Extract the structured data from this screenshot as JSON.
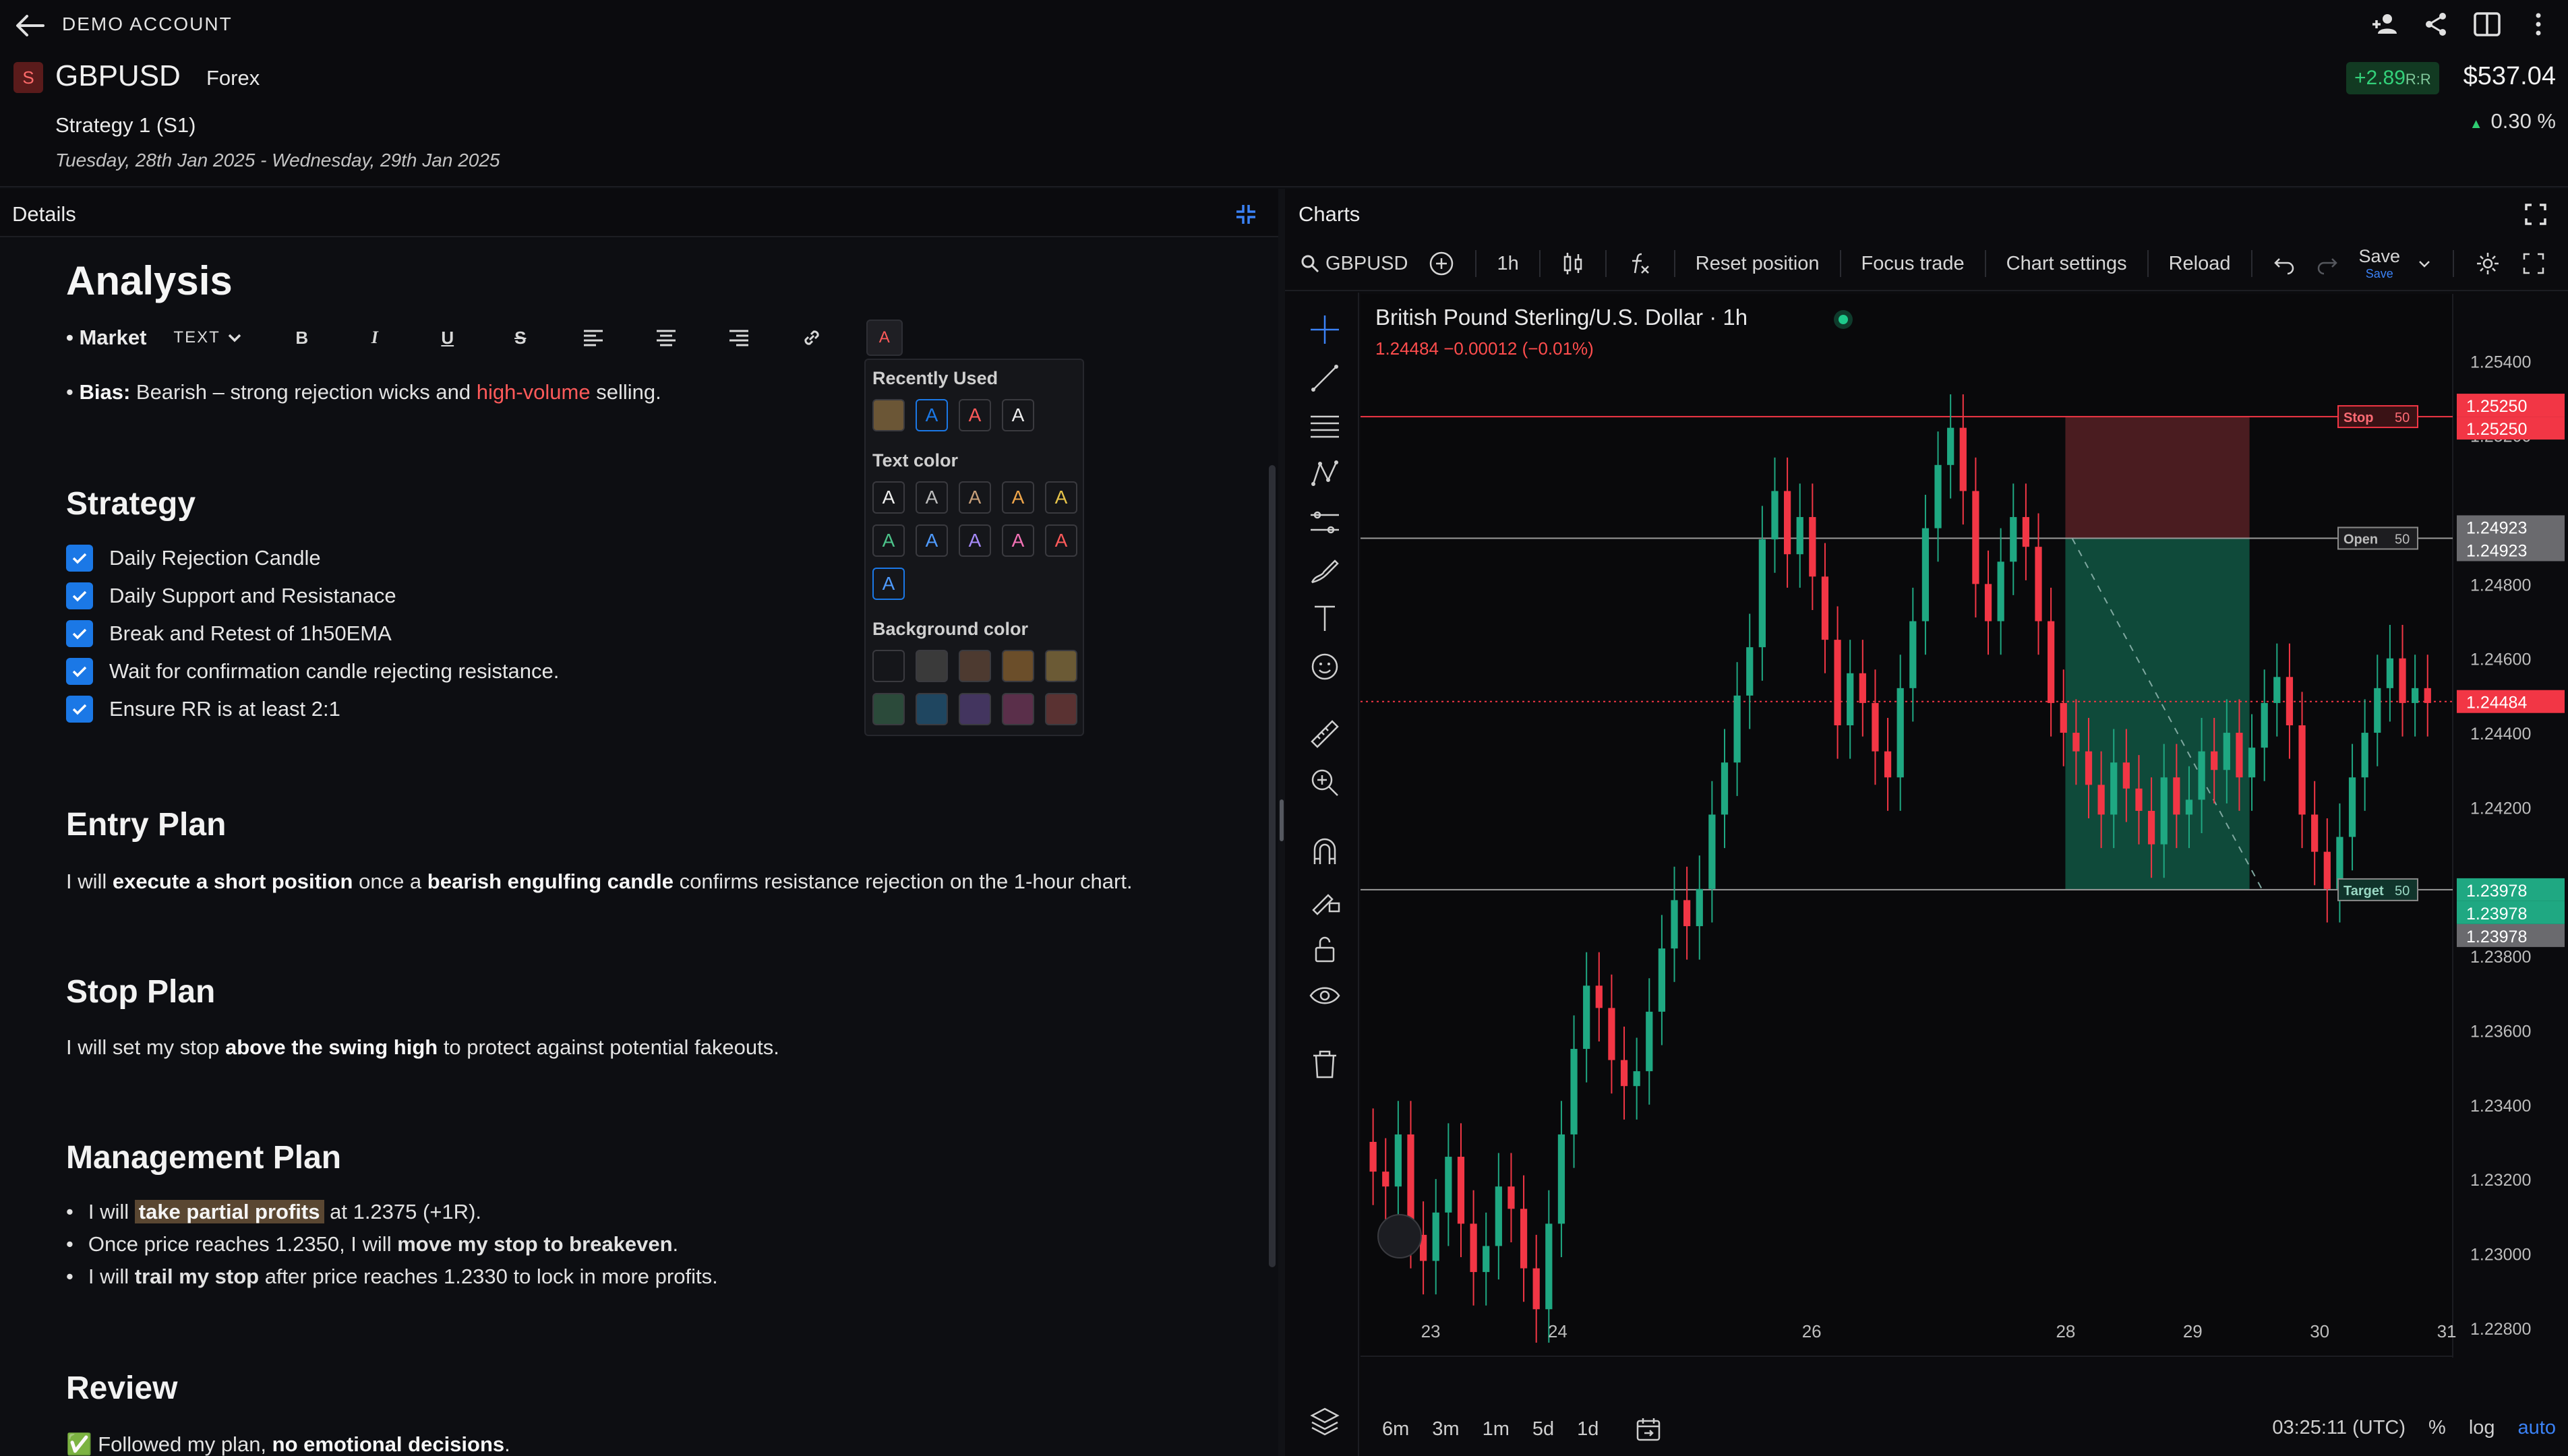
{
  "header": {
    "account_title": "DEMO ACCOUNT",
    "badge_letter": "S",
    "symbol": "GBPUSD",
    "market_type": "Forex",
    "strategy_name": "Strategy 1 (S1)",
    "date_range": "Tuesday, 28th Jan 2025 - Wednesday, 29th Jan 2025",
    "rr_value": "+2.89",
    "rr_unit": "R:R",
    "pnl_value": "$537.04",
    "pnl_percent": "0.30 %"
  },
  "details": {
    "panel_title": "Details",
    "analysis_heading": "Analysis",
    "market_label": "Market",
    "text_dropdown": "TEXT",
    "format_buttons": [
      "B",
      "I",
      "U",
      "S"
    ],
    "bias_label": "Bias:",
    "bias_text_1": " Bearish – strong rejection wicks and ",
    "bias_text_red": "high-volume",
    "bias_text_2": " selling.",
    "strategy_heading": "Strategy",
    "strategy_items": [
      "Daily Rejection Candle",
      "Daily Support and Resistanace",
      "Break and Retest of 1h50EMA",
      "Wait for confirmation candle rejecting resistance.",
      "Ensure RR is at least 2:1"
    ],
    "entry_heading": "Entry Plan",
    "entry_t1": "I will ",
    "entry_b1": "execute a short position",
    "entry_t2": " once a ",
    "entry_b2": "bearish engulfing candle",
    "entry_t3": " confirms resistance rejection on the 1-hour chart.",
    "stop_heading": "Stop Plan",
    "stop_t1": "I will set my stop ",
    "stop_b1": "above the swing high",
    "stop_t2": " to protect against potential fakeouts.",
    "mgmt_heading": "Management Plan",
    "mgmt_1a": "I will ",
    "mgmt_1b": "take partial profits",
    "mgmt_1c": " at 1.2375 (+1R).",
    "mgmt_2a": "Once price reaches 1.2350, I will ",
    "mgmt_2b": "move my stop to breakeven",
    "mgmt_2c": ".",
    "mgmt_3a": "I will ",
    "mgmt_3b": "trail my stop",
    "mgmt_3c": " after price reaches 1.2330 to lock in more profits.",
    "review_heading": "Review",
    "review_t1": "✅ Followed my plan, ",
    "review_b1": "no emotional decisions",
    "review_t2": "."
  },
  "color_popup": {
    "recently_used_label": "Recently Used",
    "text_color_label": "Text color",
    "background_color_label": "Background color",
    "swatch_letter": "A",
    "recent_colors": [
      "#6b5636",
      "#1b78e6",
      "#ff5a5a",
      "#f0f0f0"
    ],
    "text_colors": [
      "#f0f0f0",
      "#bdbdbd",
      "#c8a07a",
      "#f0a64a",
      "#e6c34a",
      "#4cc38a",
      "#4f9bff",
      "#a78bfa",
      "#f472b6",
      "#ff5a5a",
      "#4f9bff"
    ],
    "bg_colors": [
      "#15161a",
      "#3a3a3a",
      "#4d3a30",
      "#6b4e2a",
      "#6b5a35",
      "#2b4a3a",
      "#1f4660",
      "#43355f",
      "#5a2f4a",
      "#5a3232"
    ]
  },
  "charts": {
    "panel_title": "Charts",
    "toolbar": {
      "symbol": "GBPUSD",
      "interval": "1h",
      "reset_position": "Reset position",
      "focus_trade": "Focus trade",
      "chart_settings": "Chart settings",
      "reload": "Reload",
      "save": "Save",
      "save_sub": "Save"
    },
    "chart_title": "British Pound Sterling/U.S. Dollar · 1h",
    "ohlc_line": "1.24484  −0.00012 (−0.01%)",
    "bottom_intervals": [
      "6m",
      "3m",
      "1m",
      "5d",
      "1d"
    ],
    "time_utc": "03:25:11 (UTC)",
    "bottom_pct": "%",
    "bottom_log": "log",
    "bottom_auto": "auto",
    "colors": {
      "up": "#1fa882",
      "down": "#f23645",
      "profit_zone": "#0f4a3a",
      "loss_zone": "#4a1c20"
    }
  },
  "chart_data": {
    "type": "candlestick",
    "title": "British Pound Sterling/U.S. Dollar · 1h",
    "x_ticks": [
      "23",
      "24",
      "26",
      "28",
      "29",
      "30",
      "31"
    ],
    "y_ticks": [
      "1.25400",
      "1.25200",
      "1.24800",
      "1.24600",
      "1.24400",
      "1.24200",
      "1.23800",
      "1.23600",
      "1.23400",
      "1.23200",
      "1.23000",
      "1.22800"
    ],
    "ylim": [
      1.2272,
      1.2558
    ],
    "xlim": [
      22.45,
      31.05
    ],
    "stop_price": 1.2525,
    "open_price": 1.24923,
    "target_price": 1.23978,
    "current_price": 1.24484,
    "trade_start_x": 28.0,
    "trade_end_x": 29.45,
    "exit_x": 29.55,
    "price_labels": {
      "stop": [
        "1.25250",
        "1.25250"
      ],
      "open": [
        "1.24923",
        "1.24923"
      ],
      "target": [
        "1.23978",
        "1.23978",
        "1.23978"
      ],
      "current": "1.24484"
    },
    "line_tags": {
      "stop": "Stop",
      "open": "Open",
      "target": "Target",
      "qty": "50"
    },
    "closes": [
      1.2322,
      1.2318,
      1.2332,
      1.2305,
      1.2298,
      1.2311,
      1.2326,
      1.2308,
      1.2295,
      1.2302,
      1.2318,
      1.2312,
      1.2296,
      1.2285,
      1.2308,
      1.2332,
      1.2355,
      1.2372,
      1.2366,
      1.2352,
      1.2345,
      1.2349,
      1.2365,
      1.2382,
      1.2395,
      1.2388,
      1.2398,
      1.2418,
      1.2432,
      1.245,
      1.2463,
      1.2492,
      1.2505,
      1.2488,
      1.2498,
      1.2482,
      1.2465,
      1.2442,
      1.2456,
      1.2448,
      1.2435,
      1.2428,
      1.2452,
      1.247,
      1.2495,
      1.2512,
      1.2522,
      1.2505,
      1.248,
      1.247,
      1.2486,
      1.2498,
      1.249,
      1.247,
      1.2448,
      1.244,
      1.2435,
      1.2426,
      1.2418,
      1.2432,
      1.2425,
      1.2419,
      1.241,
      1.2428,
      1.2418,
      1.2422,
      1.2435,
      1.243,
      1.244,
      1.2428,
      1.2436,
      1.2448,
      1.2455,
      1.2442,
      1.2418,
      1.2408,
      1.2398,
      1.2412,
      1.2428,
      1.244,
      1.2452,
      1.246,
      1.2448,
      1.2452,
      1.2448
    ]
  }
}
